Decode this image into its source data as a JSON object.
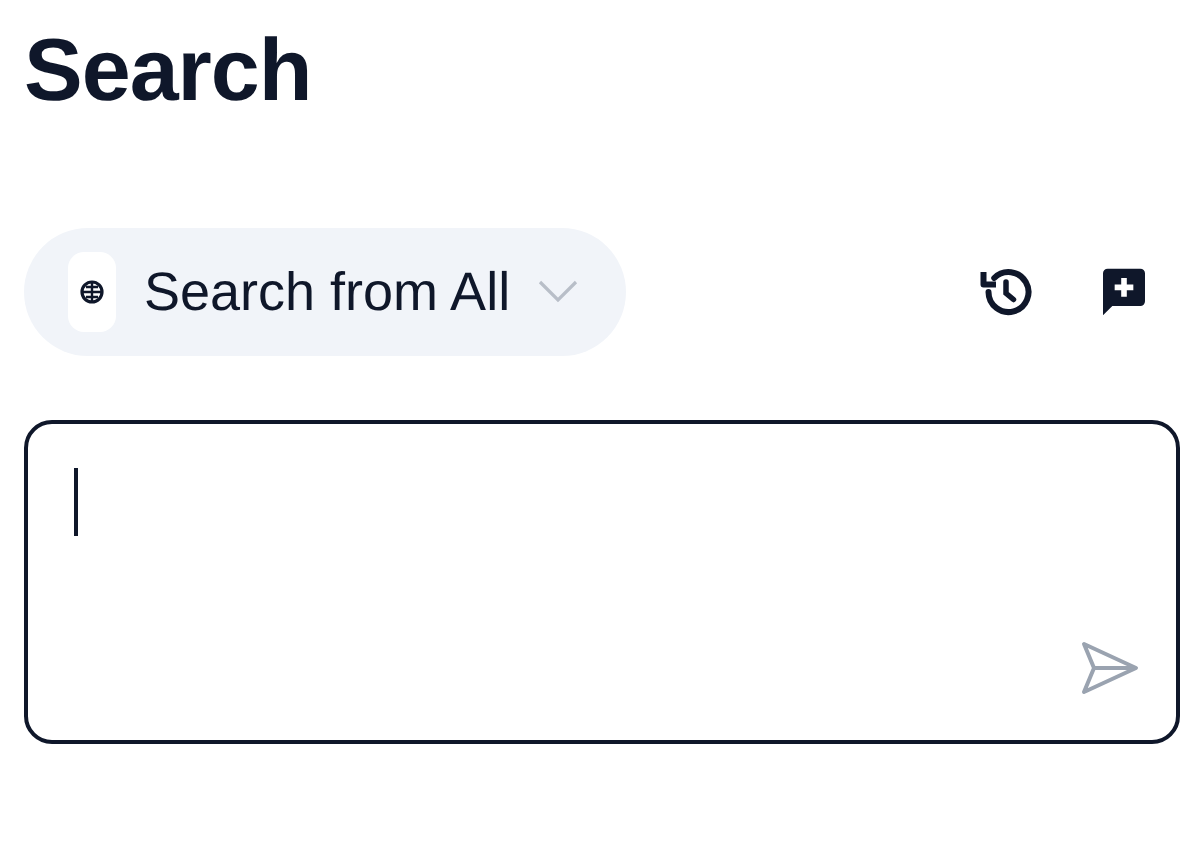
{
  "title": "Search",
  "source_selector": {
    "label": "Search from All"
  }
}
